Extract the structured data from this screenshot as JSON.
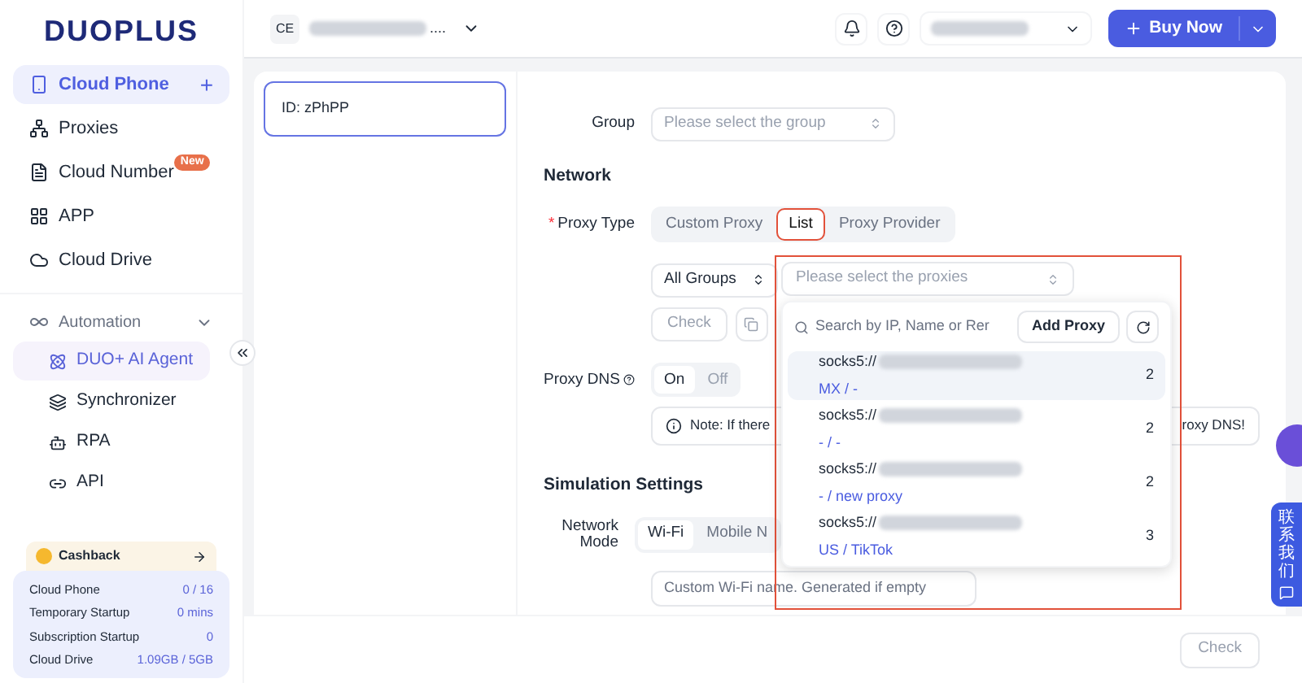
{
  "logo": "DUOPLUS",
  "sidebar": {
    "items": [
      {
        "label": "Cloud Phone",
        "selected": true,
        "add": "+"
      },
      {
        "label": "Proxies",
        "selected": false
      },
      {
        "label": "Cloud Number",
        "selected": false,
        "badge": "New"
      },
      {
        "label": "APP",
        "selected": false
      },
      {
        "label": "Cloud Drive",
        "selected": false
      }
    ],
    "automation": {
      "label": "Automation",
      "expanded": true,
      "children": [
        {
          "label": "DUO+ AI Agent",
          "selected": true
        },
        {
          "label": "Synchronizer",
          "selected": false
        },
        {
          "label": "RPA",
          "selected": false
        },
        {
          "label": "API",
          "selected": false
        }
      ]
    },
    "cashback": "Cashback",
    "stats": [
      {
        "label": "Cloud Phone",
        "value": "0 / 16"
      },
      {
        "label": "Temporary Startup",
        "value": "0 mins"
      },
      {
        "label": "Subscription Startup",
        "value": "0"
      },
      {
        "label": "Cloud Drive",
        "value": "1.09GB / 5GB"
      }
    ]
  },
  "header": {
    "team_initials": "CE",
    "team_name_suffix": "....",
    "buy_button": "Buy Now"
  },
  "device_card": {
    "label": "ID: zPhPP",
    "selected": true
  },
  "form": {
    "group": {
      "label": "Group",
      "placeholder": "Please select the group"
    },
    "network_heading": "Network",
    "proxy_type": {
      "label": "Proxy Type",
      "required_mark": "*",
      "tabs": [
        {
          "label": "Custom Proxy",
          "selected": false
        },
        {
          "label": "List",
          "selected": true
        },
        {
          "label": "Proxy Provider",
          "selected": false
        }
      ]
    },
    "groups_select": "All Groups",
    "check_button": "Check",
    "proxy_select": {
      "placeholder": "Please select the proxies"
    },
    "proxy_dns": {
      "label": "Proxy DNS",
      "options": [
        {
          "label": "On",
          "selected": true
        },
        {
          "label": "Off",
          "selected": false
        }
      ]
    },
    "note": {
      "start": "Note: If there",
      "end": "roxy DNS!"
    },
    "simulation_heading": "Simulation Settings",
    "network_mode": {
      "label": "Network Mode",
      "options": [
        {
          "label": "Wi-Fi",
          "selected": true
        },
        {
          "label": "Mobile N",
          "selected": false
        }
      ]
    },
    "wifi_name": {
      "placeholder": "Custom Wi-Fi name. Generated if empty"
    }
  },
  "dropdown": {
    "search_placeholder": "Search by IP, Name or Rer",
    "add_button": "Add Proxy",
    "items": [
      {
        "prefix": "socks5://",
        "tags": "MX / -",
        "count": "2",
        "selected": true
      },
      {
        "prefix": "socks5://",
        "tags": "- / -",
        "count": "2",
        "selected": false
      },
      {
        "prefix": "socks5://",
        "tags": "- / new proxy",
        "count": "2",
        "selected": false
      },
      {
        "prefix": "socks5://",
        "tags": "US / TikTok",
        "count": "3",
        "selected": false
      }
    ]
  },
  "footer": {
    "check_button": "Check"
  },
  "contact_tab": "联系我们"
}
